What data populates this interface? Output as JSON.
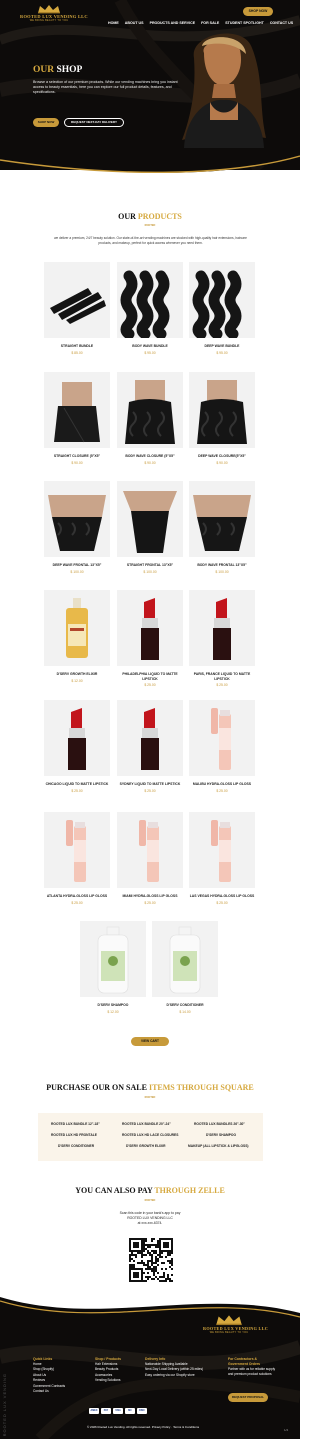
{
  "header": {
    "logo_name": "ROOTED LUX VENDING LLC",
    "logo_sub": "WE BRING BEAUTY TO YOU",
    "nav": [
      "HOME",
      "ABOUT US",
      "PRODUCTS AND SERVICE",
      "FOR SALE",
      "STUDENT SPOTLIGHT",
      "CONTACT US"
    ],
    "cta": "SHOP NOW"
  },
  "hero": {
    "title_a": "OUR",
    "title_b": "SHOP",
    "text": "Browse a selection of our premium products. While our vending machines bring you instant access to beauty essentials, here you can explore our full product details, features, and specifications.",
    "btn_shop": "SHOP NOW",
    "btn_delivery": "REQUEST NEXT-DAY DELIVERY"
  },
  "products_section": {
    "title_a": "OUR",
    "title_b": "PRODUCTS",
    "sub": "ROOTED",
    "intro": "we deliver a premium, 24/7 beauty solution. Our state-of-the-art vending machines are stocked with high-quality hair extensions, haircare products, and makeup, perfect for quick access whenever you need them."
  },
  "products": [
    {
      "name": "STRAIGHT BUNDLE",
      "price": "$ 85.00"
    },
    {
      "name": "BODY WAVE BUNDLE",
      "price": "$ 95.00"
    },
    {
      "name": "DEEP WAVE BUNDLE",
      "price": "$ 95.00"
    },
    {
      "name": "STRAIGHT CLOSURE (5\"X5\"",
      "price": "$ 90.00"
    },
    {
      "name": "BODY WAVE CLOSURE (5\"X5\"",
      "price": "$ 90.00"
    },
    {
      "name": "DEEP WAVE CLOSURE(5\"X5\"",
      "price": "$ 90.00"
    },
    {
      "name": "DEEP WAVE FRONTAL 13\"X5\"",
      "price": "$ 100.00"
    },
    {
      "name": "STRAIGHT FRONTAL 13\"X5\"",
      "price": "$ 100.00"
    },
    {
      "name": "BODY WAVE FRONTAL 13\"X5\"",
      "price": "$ 100.00"
    },
    {
      "name": "D'SERV GROWTH ELIXIR",
      "price": "$ 12.00"
    },
    {
      "name": "PHILADELPHIA LIQUID TO MATTE LIPSTICK",
      "price": "$ 25.00"
    },
    {
      "name": "PARIS, FRANCE LIQUID TO MATTE LIPSTICK",
      "price": "$ 25.00"
    },
    {
      "name": "CHICAGO LIQUID TO MATTE LIPSTICK",
      "price": "$ 25.00"
    },
    {
      "name": "SYDNEY LIQUID TO MATTE LIPSTICK",
      "price": "$ 25.00"
    },
    {
      "name": "MALIBU HYDRA-GLOSS LIP GLOSS",
      "price": "$ 25.00"
    },
    {
      "name": "ATLANTA HYDRA-GLOSS LIP GLOSS",
      "price": "$ 25.00"
    },
    {
      "name": "MIAMI HYDRA-GLOSS LIP GLOSS",
      "price": "$ 25.00"
    },
    {
      "name": "LAS VEGAS HYDRA-GLOSS LIP GLOSS",
      "price": "$ 25.00"
    },
    {
      "name": "D'SERV SHAMPOO",
      "price": "$ 12.00"
    },
    {
      "name": "D'SERV CONDITIONER",
      "price": "$ 14.00"
    }
  ],
  "view_cart": "VIEW CART",
  "square": {
    "title_a": "PURCHASE OUR ON SALE",
    "title_b": "ITEMS THROUGH SQUARE",
    "sub": "ROOTED",
    "items": [
      "ROOTED LUX BUNDLE 12\"-18\"",
      "ROOTED LUX BUNDLE 20\"-24\"",
      "ROOTED LUX BUNDLES 26\"-30\"",
      "ROOTED LUX HD FRONTALE",
      "ROOTED LUX HD LACE CLOSURES",
      "D'SERV SHAMPOO",
      "D'SERV CONDITIONER",
      "D'SERV GROWTH ELIXIR",
      "MAKEUP (ALL LIPSTICK & LIPGLOSS)"
    ]
  },
  "zelle": {
    "title_a": "YOU CAN ALSO PAY",
    "title_b": "THROUGH ZELLE",
    "sub": "ROOTED",
    "line1": "Scan this code in your bank's app to pay",
    "line2": "ROOTED LUX VENDING LLC",
    "line3": "at xxx-xxx-6374."
  },
  "footer": {
    "logo_name": "ROOTED LUX VENDING LLC",
    "logo_sub": "WE BRING BEAUTY TO YOU",
    "col1_h": "Quick Links",
    "col1": [
      "Home",
      "Shop (Shopify)",
      "About Us",
      "Reviews",
      "Government Contracts",
      "Contact Us"
    ],
    "col2_h": "Shop / Products",
    "col2": [
      "Hair Extensions",
      "Beauty Products",
      "Accessories",
      "Vending Solutions"
    ],
    "col3_h": "Delivery Info",
    "col3": [
      "Nationwide Shipping Available",
      "Next-Day Local Delivery (within 25 miles)",
      "Easy ordering via our Shopify store"
    ],
    "col4_h": "For Contractors & Government Orders",
    "col4": "Partner with us for reliable supply and premium product solutions",
    "col4_btn": "REQUEST PROPOSAL",
    "payments": [
      "AMEX",
      "PAY",
      "VISA",
      "MC",
      "DISC"
    ],
    "copyright": "© 2026 Rooted Lux Vending. All rights reserved.",
    "privacy": "Privacy Policy",
    "terms": "Terms & Conditions",
    "vertical": "ROOTED LUX VENDING",
    "corner": "1/4"
  },
  "colors": {
    "gold": "#d6a93f",
    "dark": "#0d0b0a",
    "button_gold": "#c79a3a"
  }
}
